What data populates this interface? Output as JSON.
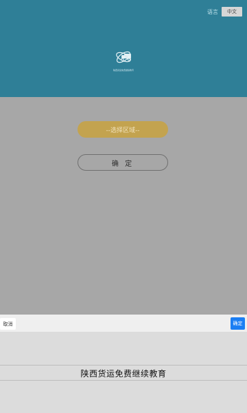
{
  "header": {
    "language_label": "语言",
    "language_button": "中文",
    "logo_icon": "truck-atom-logo-icon",
    "logo_caption": "陕西货运免费继续教育"
  },
  "main": {
    "select_region_label": "--选择区域--",
    "confirm_label": "确 定"
  },
  "picker": {
    "cancel_label": "取消",
    "ok_label": "确定",
    "selected_option": "陕西货运免费继续教育"
  },
  "colors": {
    "header_bg": "#2f7f97",
    "overlay_bg": "#a7a7a7",
    "select_button": "#c3a34f",
    "picker_ok": "#1b7ef3"
  }
}
